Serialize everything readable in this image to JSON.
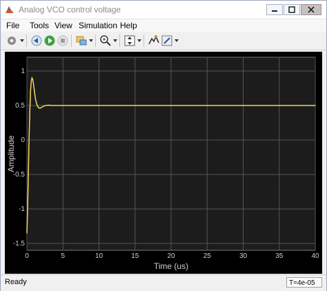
{
  "window": {
    "title": "Analog VCO control voltage"
  },
  "menu": {
    "items": [
      "File",
      "Tools",
      "View",
      "Simulation",
      "Help"
    ]
  },
  "toolbar": {
    "buttons": [
      "settings-icon",
      "step-back-icon",
      "run-icon",
      "stop-icon",
      "highlight-icon",
      "zoom-icon",
      "scale-axes-icon",
      "signal-selector-icon",
      "edit-icon"
    ]
  },
  "status": {
    "text": "Ready",
    "time": "T=4e-05"
  },
  "colors": {
    "plot_bg": "#000000",
    "axes_bg": "#1c1c1c",
    "signal": "#f7d75a",
    "grid": "#555555"
  },
  "chart_data": {
    "type": "line",
    "xlabel": "Time (us)",
    "ylabel": "Amplitude",
    "xlim": [
      0,
      40
    ],
    "ylim": [
      -1.6,
      1.2
    ],
    "xticks": [
      0,
      5,
      10,
      15,
      20,
      25,
      30,
      35,
      40
    ],
    "yticks": [
      1,
      0.5,
      0,
      -0.5,
      -1,
      -1.5
    ],
    "grid": true,
    "series": [
      {
        "x": [
          0,
          0.1,
          0.2,
          0.3,
          0.4,
          0.5,
          0.6,
          0.7,
          0.8,
          0.9,
          1.0,
          1.1,
          1.2,
          1.4,
          1.6,
          1.8,
          2.0,
          2.3,
          2.6,
          3.0,
          3.5,
          4.0,
          5,
          10,
          15,
          20,
          25,
          30,
          35,
          40
        ],
        "y": [
          -1.35,
          -1.0,
          -0.5,
          0.0,
          0.4,
          0.7,
          0.85,
          0.9,
          0.88,
          0.82,
          0.74,
          0.66,
          0.59,
          0.51,
          0.47,
          0.46,
          0.47,
          0.49,
          0.5,
          0.505,
          0.5,
          0.5,
          0.5,
          0.5,
          0.5,
          0.5,
          0.5,
          0.5,
          0.5,
          0.5
        ]
      }
    ]
  }
}
